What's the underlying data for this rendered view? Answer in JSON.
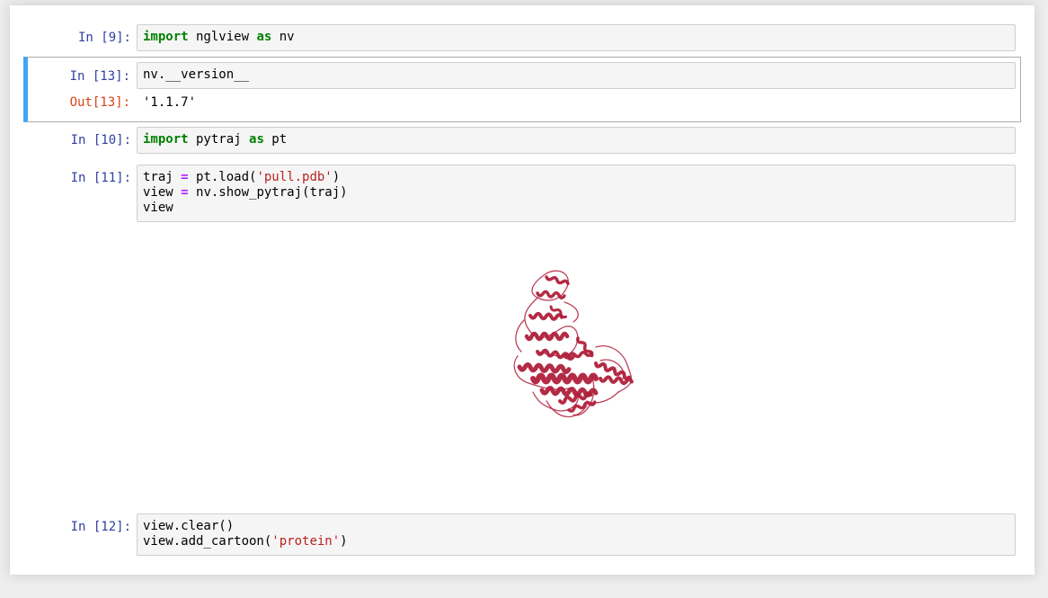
{
  "cells": [
    {
      "prompt": "In [9]:",
      "code": [
        [
          [
            "kw",
            "import"
          ],
          [
            "t",
            " nglview "
          ],
          [
            "kw",
            "as"
          ],
          [
            "t",
            " nv"
          ]
        ]
      ]
    },
    {
      "prompt": "In [13]:",
      "code": [
        [
          [
            "t",
            "nv.__version__"
          ]
        ]
      ],
      "output_prompt": "Out[13]:",
      "output": "'1.1.7'"
    },
    {
      "prompt": "In [10]:",
      "code": [
        [
          [
            "kw",
            "import"
          ],
          [
            "t",
            " pytraj "
          ],
          [
            "kw",
            "as"
          ],
          [
            "t",
            " pt"
          ]
        ]
      ]
    },
    {
      "prompt": "In [11]:",
      "code": [
        [
          [
            "t",
            "traj "
          ],
          [
            "op",
            "="
          ],
          [
            "t",
            " pt.load("
          ],
          [
            "str",
            "'pull.pdb'"
          ],
          [
            "t",
            ")"
          ]
        ],
        [
          [
            "t",
            "view "
          ],
          [
            "op",
            "="
          ],
          [
            "t",
            " nv.show_pytraj(traj)"
          ]
        ],
        [
          [
            "t",
            "view"
          ]
        ]
      ],
      "widget": "protein-cartoon-render",
      "widget_color": "#b0203c"
    },
    {
      "prompt": "In [12]:",
      "code": [
        [
          [
            "t",
            "view.clear()"
          ]
        ],
        [
          [
            "t",
            "view.add_cartoon("
          ],
          [
            "str",
            "'protein'"
          ],
          [
            "t",
            ")"
          ]
        ]
      ]
    }
  ],
  "colors": {
    "in_prompt": "#303f9f",
    "out_prompt": "#d84315",
    "selected_border": "#42a5f5",
    "keyword": "#008000",
    "operator": "#aa22ff",
    "string": "#ba2121"
  }
}
